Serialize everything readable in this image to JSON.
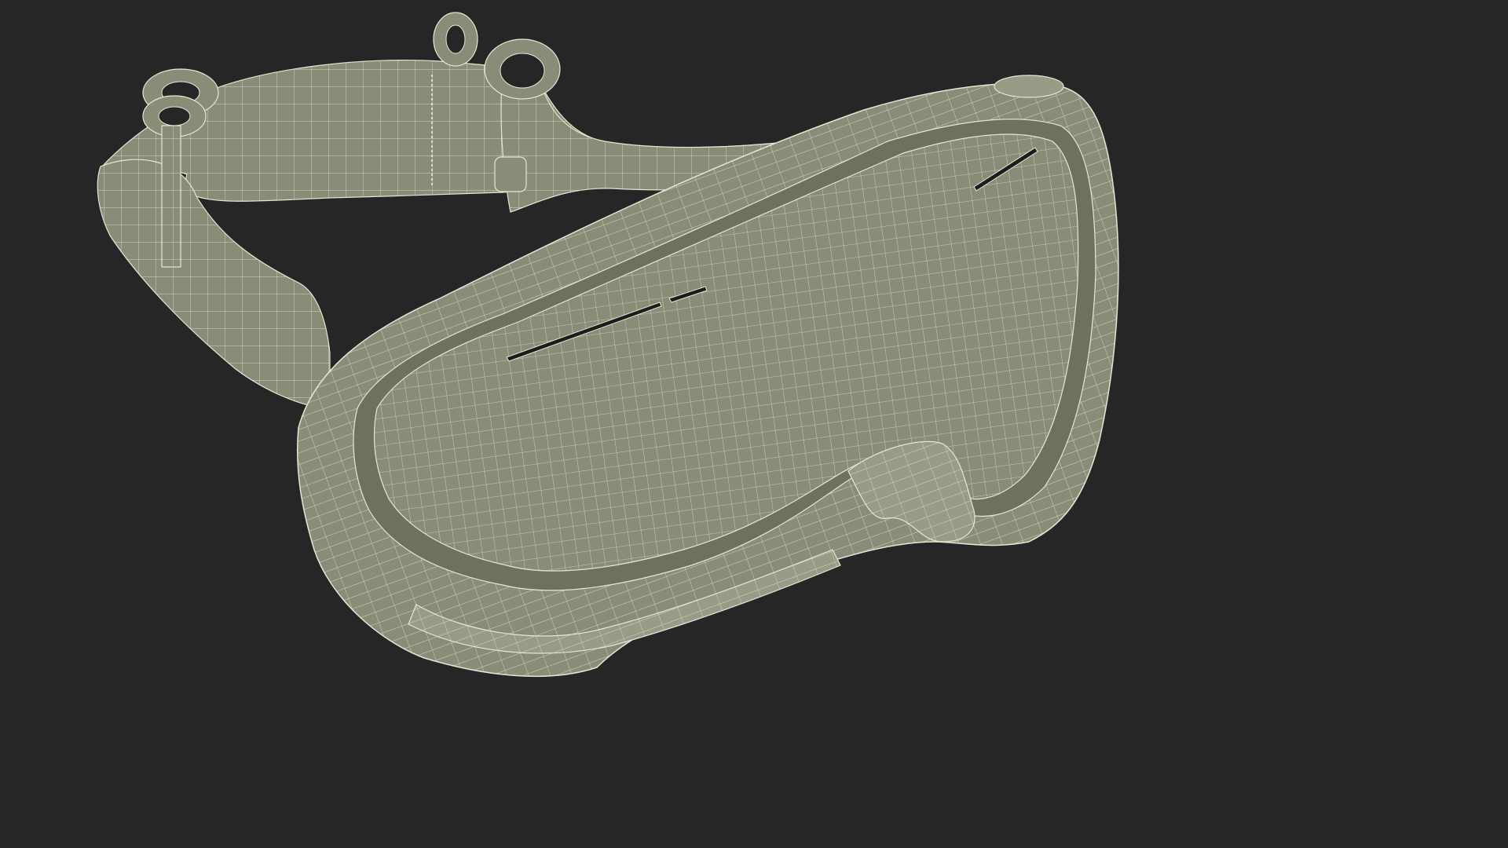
{
  "scene": {
    "subject": "ski-goggles-wireframe",
    "colors": {
      "background": "#262626",
      "surface": "#8b8c78",
      "surface_light": "#9a9b86",
      "surface_dark": "#6f705f",
      "wire": "#e6e6d6",
      "slot": "#1c1c1c"
    }
  }
}
